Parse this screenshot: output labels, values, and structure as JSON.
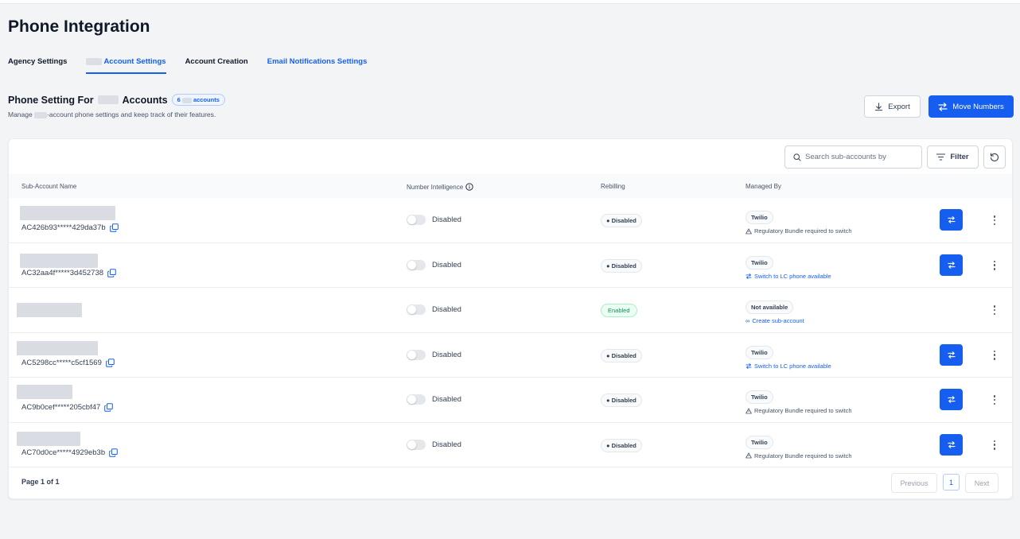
{
  "page": {
    "title": "Phone Integration"
  },
  "tabs": [
    {
      "label": "Agency Settings"
    },
    {
      "label": "Account Settings"
    },
    {
      "label": "Account Creation"
    },
    {
      "label": "Email Notifications Settings"
    }
  ],
  "section": {
    "title_prefix": "Phone Setting For",
    "title_suffix": "Accounts",
    "count_prefix": "6",
    "count_suffix": "accounts",
    "desc_prefix": "Manage",
    "desc_suffix": "-account phone settings and keep track of their features."
  },
  "actions": {
    "export_label": "Export",
    "move_label": "Move Numbers"
  },
  "toolbar": {
    "search_placeholder": "Search sub-accounts by",
    "filter_label": "Filter"
  },
  "table": {
    "headers": {
      "name": "Sub-Account Name",
      "intelligence": "Number Intelligence",
      "rebilling": "Rebilling",
      "managed_by": "Managed By"
    },
    "rows": [
      {
        "sid": "AC426b93*****429da37b",
        "intelligence": "Disabled",
        "rebilling": "Disabled",
        "managed_by": "Twilio",
        "note": "Regulatory Bundle required to switch"
      },
      {
        "sid": "AC32aa4f*****3d452738",
        "intelligence": "Disabled",
        "rebilling": "Disabled",
        "managed_by": "Twilio",
        "note": "Switch to LC phone available"
      },
      {
        "sid": "",
        "intelligence": "Disabled",
        "rebilling": "Enabled",
        "managed_by": "Not available",
        "note": "Create sub-account"
      },
      {
        "sid": "AC5298cc*****c5cf1569",
        "intelligence": "Disabled",
        "rebilling": "Disabled",
        "managed_by": "Twilio",
        "note": "Switch to LC phone available"
      },
      {
        "sid": "AC9b0cef*****205cbf47",
        "intelligence": "Disabled",
        "rebilling": "Disabled",
        "managed_by": "Twilio",
        "note": "Regulatory Bundle required to switch"
      },
      {
        "sid": "AC70d0ce*****4929eb3b",
        "intelligence": "Disabled",
        "rebilling": "Disabled",
        "managed_by": "Twilio",
        "note": "Regulatory Bundle required to switch"
      }
    ]
  },
  "pagination": {
    "label": "Page 1 of 1",
    "previous": "Previous",
    "current": "1",
    "next": "Next"
  },
  "colors": {
    "accent": "#155eef",
    "enabled_green": "#079455"
  }
}
